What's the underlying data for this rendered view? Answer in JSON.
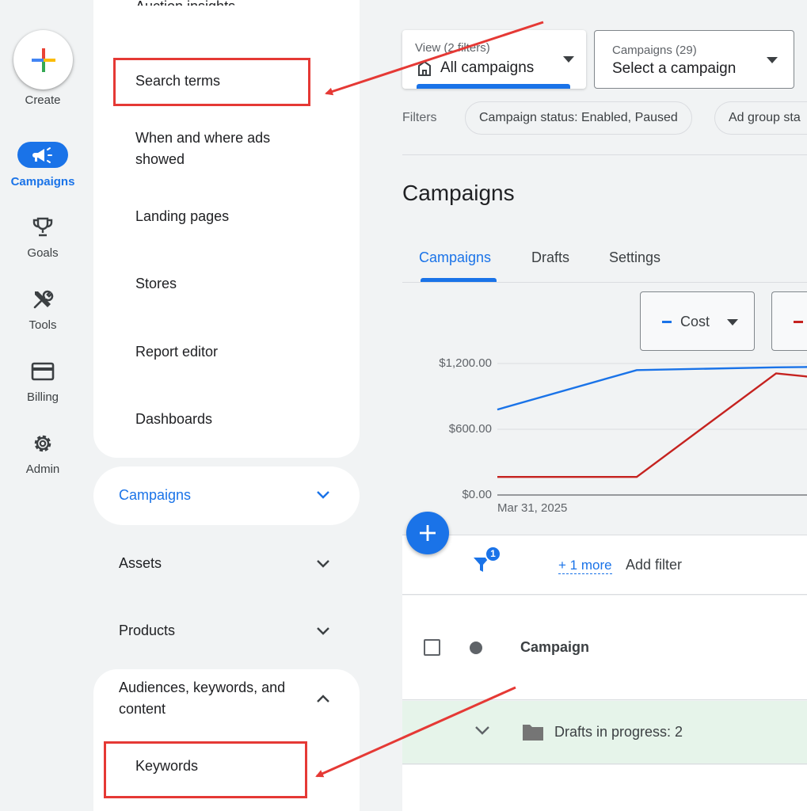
{
  "rail": {
    "create_label": "Create",
    "items": [
      {
        "label": "Campaigns",
        "icon": "megaphone-icon",
        "active": true
      },
      {
        "label": "Goals",
        "icon": "trophy-icon"
      },
      {
        "label": "Tools",
        "icon": "tools-icon"
      },
      {
        "label": "Billing",
        "icon": "credit-card-icon"
      },
      {
        "label": "Admin",
        "icon": "gear-icon"
      }
    ]
  },
  "nav": {
    "top_items": [
      "Auction insights",
      "Search terms",
      "When and where ads showed",
      "Landing pages",
      "Stores",
      "Report editor",
      "Dashboards"
    ],
    "sections": [
      {
        "label": "Campaigns",
        "expanded": false,
        "active": true
      },
      {
        "label": "Assets",
        "expanded": false
      },
      {
        "label": "Products",
        "expanded": false
      },
      {
        "label": "Audiences, keywords, and content",
        "expanded": true
      }
    ],
    "audience_items": [
      "Keywords"
    ]
  },
  "toolbar": {
    "view_small": "View (2 filters)",
    "view_value": "All campaigns",
    "campaigns_small": "Campaigns (29)",
    "campaigns_value": "Select a campaign",
    "filters_label": "Filters",
    "chips": [
      "Campaign status: Enabled, Paused",
      "Ad group sta"
    ]
  },
  "page": {
    "title": "Campaigns",
    "tabs": [
      "Campaigns",
      "Drafts",
      "Settings"
    ],
    "active_tab": "Campaigns"
  },
  "chart": {
    "metric1_label": "Cost",
    "metric1_color": "#1a73e8",
    "metric2_color": "#c5221f",
    "y_ticks": [
      "$1,200.00",
      "$600.00",
      "$0.00"
    ],
    "x_label": "Mar 31, 2025"
  },
  "chart_data": {
    "type": "line",
    "ylim": [
      0,
      1200
    ],
    "x": [
      0,
      1,
      2,
      3
    ],
    "series": [
      {
        "values": [
          780,
          1140,
          1165,
          1180
        ],
        "color": "#1a73e8"
      },
      {
        "values": [
          165,
          165,
          1110,
          980
        ],
        "color": "#c5221f"
      }
    ]
  },
  "table": {
    "filter_badge": "1",
    "more_link": "+ 1 more",
    "add_filter": "Add filter",
    "header_campaign": "Campaign",
    "drafts_row": "Drafts in progress: 2"
  },
  "annotation_colors": {
    "arrow": "#e53935"
  }
}
